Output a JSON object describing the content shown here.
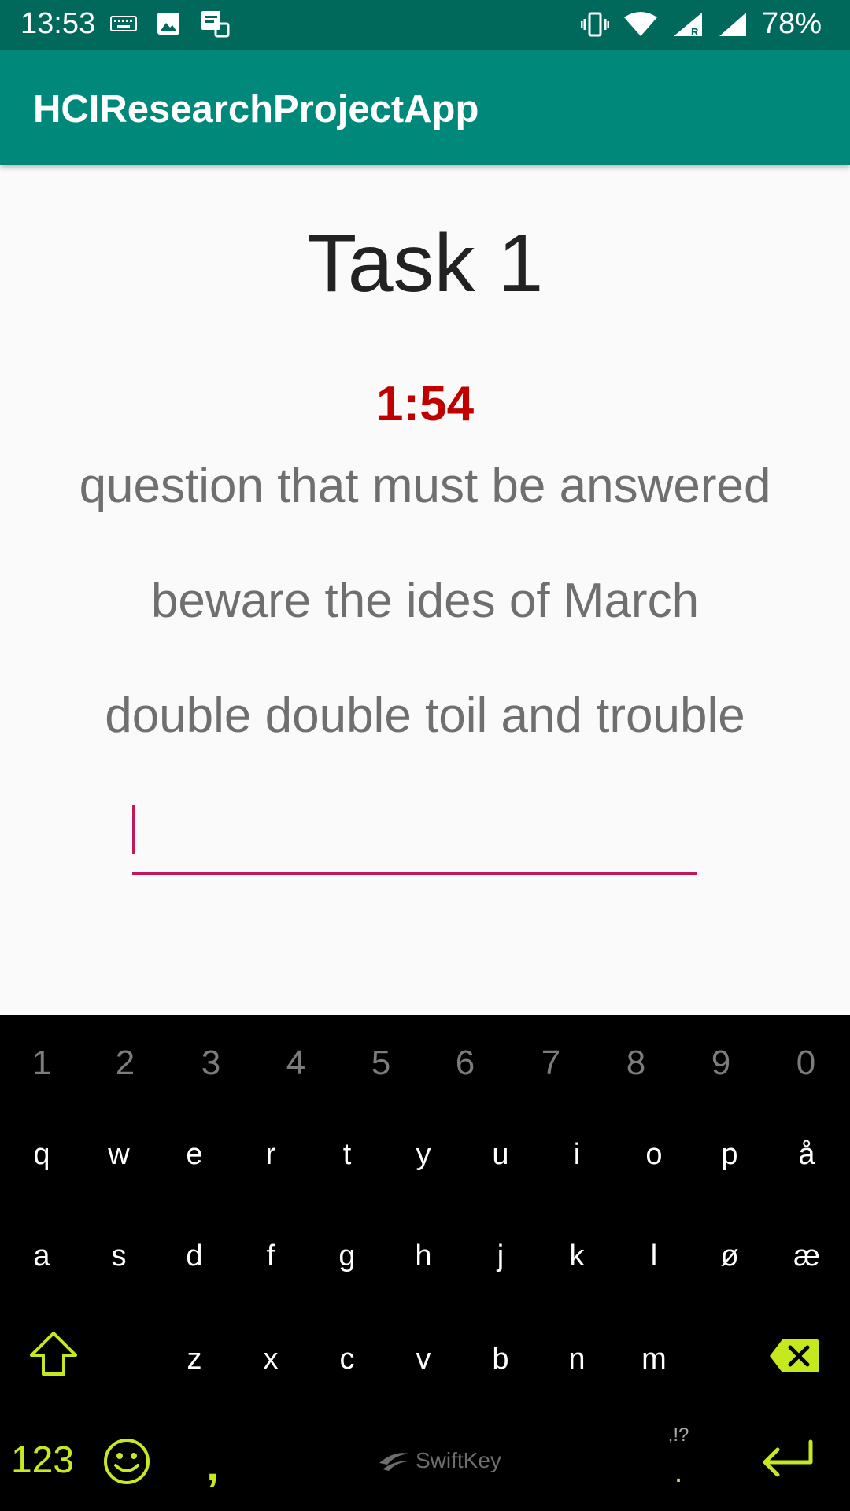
{
  "status_bar": {
    "time": "13:53",
    "battery": "78%",
    "left_icons": [
      "keyboard-icon",
      "image-icon",
      "storage-icon"
    ],
    "right_icons": [
      "vibrate-icon",
      "wifi-icon",
      "signal-roaming-icon",
      "signal-icon"
    ]
  },
  "app_bar": {
    "title": "HCIResearchProjectApp"
  },
  "task": {
    "title": "Task 1",
    "timer": "1:54",
    "phrases": [
      "question that must be answered",
      "beware the ides of March",
      "double double toil and trouble"
    ],
    "answer_value": ""
  },
  "keyboard": {
    "number_row": [
      "1",
      "2",
      "3",
      "4",
      "5",
      "6",
      "7",
      "8",
      "9",
      "0"
    ],
    "row1": [
      "q",
      "w",
      "e",
      "r",
      "t",
      "y",
      "u",
      "i",
      "o",
      "p",
      "å"
    ],
    "row2": [
      "a",
      "s",
      "d",
      "f",
      "g",
      "h",
      "j",
      "k",
      "l",
      "ø",
      "æ"
    ],
    "row3": [
      "z",
      "x",
      "c",
      "v",
      "b",
      "n",
      "m"
    ],
    "numbers_key": "123",
    "comma": ",",
    "punct_hint": ",!?",
    "period": ".",
    "logo_text": "SwiftKey",
    "accent_color": "#c6e81f"
  }
}
